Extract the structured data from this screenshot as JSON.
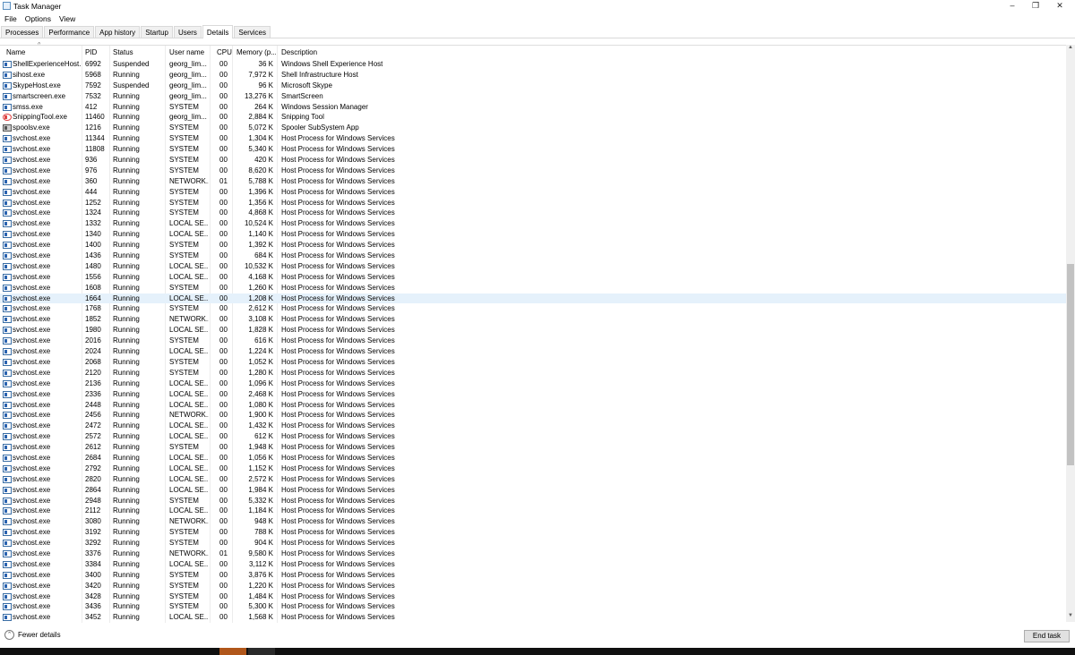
{
  "window": {
    "title": "Task Manager",
    "minimize": "–",
    "restore": "❐",
    "close": "✕"
  },
  "menu": [
    "File",
    "Options",
    "View"
  ],
  "tabs": [
    "Processes",
    "Performance",
    "App history",
    "Startup",
    "Users",
    "Details",
    "Services"
  ],
  "active_tab": "Details",
  "columns": [
    "Name",
    "PID",
    "Status",
    "User name",
    "CPU",
    "Memory (p...",
    "Description"
  ],
  "sort_indicator": "^",
  "rows": [
    [
      "ShellExperienceHost....",
      "6992",
      "Suspended",
      "georg_lim...",
      "00",
      "36 K",
      "Windows Shell Experience Host",
      "app"
    ],
    [
      "sihost.exe",
      "5968",
      "Running",
      "georg_lim...",
      "00",
      "7,972 K",
      "Shell Infrastructure Host",
      "app"
    ],
    [
      "SkypeHost.exe",
      "7592",
      "Suspended",
      "georg_lim...",
      "00",
      "96 K",
      "Microsoft Skype",
      "app"
    ],
    [
      "smartscreen.exe",
      "7532",
      "Running",
      "georg_lim...",
      "00",
      "13,276 K",
      "SmartScreen",
      "app"
    ],
    [
      "smss.exe",
      "412",
      "Running",
      "SYSTEM",
      "00",
      "264 K",
      "Windows Session Manager",
      "app"
    ],
    [
      "SnippingTool.exe",
      "11460",
      "Running",
      "georg_lim...",
      "00",
      "2,884 K",
      "Snipping Tool",
      "snip"
    ],
    [
      "spoolsv.exe",
      "1216",
      "Running",
      "SYSTEM",
      "00",
      "5,072 K",
      "Spooler SubSystem App",
      "print"
    ],
    [
      "svchost.exe",
      "11344",
      "Running",
      "SYSTEM",
      "00",
      "1,304 K",
      "Host Process for Windows Services",
      "app"
    ],
    [
      "svchost.exe",
      "11808",
      "Running",
      "SYSTEM",
      "00",
      "5,340 K",
      "Host Process for Windows Services",
      "app"
    ],
    [
      "svchost.exe",
      "936",
      "Running",
      "SYSTEM",
      "00",
      "420 K",
      "Host Process for Windows Services",
      "app"
    ],
    [
      "svchost.exe",
      "976",
      "Running",
      "SYSTEM",
      "00",
      "8,620 K",
      "Host Process for Windows Services",
      "app"
    ],
    [
      "svchost.exe",
      "360",
      "Running",
      "NETWORK...",
      "01",
      "5,788 K",
      "Host Process for Windows Services",
      "app"
    ],
    [
      "svchost.exe",
      "444",
      "Running",
      "SYSTEM",
      "00",
      "1,396 K",
      "Host Process for Windows Services",
      "app"
    ],
    [
      "svchost.exe",
      "1252",
      "Running",
      "SYSTEM",
      "00",
      "1,356 K",
      "Host Process for Windows Services",
      "app"
    ],
    [
      "svchost.exe",
      "1324",
      "Running",
      "SYSTEM",
      "00",
      "4,868 K",
      "Host Process for Windows Services",
      "app"
    ],
    [
      "svchost.exe",
      "1332",
      "Running",
      "LOCAL SE...",
      "00",
      "10,524 K",
      "Host Process for Windows Services",
      "app"
    ],
    [
      "svchost.exe",
      "1340",
      "Running",
      "LOCAL SE...",
      "00",
      "1,140 K",
      "Host Process for Windows Services",
      "app"
    ],
    [
      "svchost.exe",
      "1400",
      "Running",
      "SYSTEM",
      "00",
      "1,392 K",
      "Host Process for Windows Services",
      "app"
    ],
    [
      "svchost.exe",
      "1436",
      "Running",
      "SYSTEM",
      "00",
      "684 K",
      "Host Process for Windows Services",
      "app"
    ],
    [
      "svchost.exe",
      "1480",
      "Running",
      "LOCAL SE...",
      "00",
      "10,532 K",
      "Host Process for Windows Services",
      "app"
    ],
    [
      "svchost.exe",
      "1556",
      "Running",
      "LOCAL SE...",
      "00",
      "4,168 K",
      "Host Process for Windows Services",
      "app"
    ],
    [
      "svchost.exe",
      "1608",
      "Running",
      "SYSTEM",
      "00",
      "1,260 K",
      "Host Process for Windows Services",
      "app"
    ],
    [
      "svchost.exe",
      "1664",
      "Running",
      "LOCAL SE...",
      "00",
      "1,208 K",
      "Host Process for Windows Services",
      "app"
    ],
    [
      "svchost.exe",
      "1768",
      "Running",
      "SYSTEM",
      "00",
      "2,612 K",
      "Host Process for Windows Services",
      "app"
    ],
    [
      "svchost.exe",
      "1852",
      "Running",
      "NETWORK...",
      "00",
      "3,108 K",
      "Host Process for Windows Services",
      "app"
    ],
    [
      "svchost.exe",
      "1980",
      "Running",
      "LOCAL SE...",
      "00",
      "1,828 K",
      "Host Process for Windows Services",
      "app"
    ],
    [
      "svchost.exe",
      "2016",
      "Running",
      "SYSTEM",
      "00",
      "616 K",
      "Host Process for Windows Services",
      "app"
    ],
    [
      "svchost.exe",
      "2024",
      "Running",
      "LOCAL SE...",
      "00",
      "1,224 K",
      "Host Process for Windows Services",
      "app"
    ],
    [
      "svchost.exe",
      "2068",
      "Running",
      "SYSTEM",
      "00",
      "1,052 K",
      "Host Process for Windows Services",
      "app"
    ],
    [
      "svchost.exe",
      "2120",
      "Running",
      "SYSTEM",
      "00",
      "1,280 K",
      "Host Process for Windows Services",
      "app"
    ],
    [
      "svchost.exe",
      "2136",
      "Running",
      "LOCAL SE...",
      "00",
      "1,096 K",
      "Host Process for Windows Services",
      "app"
    ],
    [
      "svchost.exe",
      "2336",
      "Running",
      "LOCAL SE...",
      "00",
      "2,468 K",
      "Host Process for Windows Services",
      "app"
    ],
    [
      "svchost.exe",
      "2448",
      "Running",
      "LOCAL SE...",
      "00",
      "1,080 K",
      "Host Process for Windows Services",
      "app"
    ],
    [
      "svchost.exe",
      "2456",
      "Running",
      "NETWORK...",
      "00",
      "1,900 K",
      "Host Process for Windows Services",
      "app"
    ],
    [
      "svchost.exe",
      "2472",
      "Running",
      "LOCAL SE...",
      "00",
      "1,432 K",
      "Host Process for Windows Services",
      "app"
    ],
    [
      "svchost.exe",
      "2572",
      "Running",
      "LOCAL SE...",
      "00",
      "612 K",
      "Host Process for Windows Services",
      "app"
    ],
    [
      "svchost.exe",
      "2612",
      "Running",
      "SYSTEM",
      "00",
      "1,948 K",
      "Host Process for Windows Services",
      "app"
    ],
    [
      "svchost.exe",
      "2684",
      "Running",
      "LOCAL SE...",
      "00",
      "1,056 K",
      "Host Process for Windows Services",
      "app"
    ],
    [
      "svchost.exe",
      "2792",
      "Running",
      "LOCAL SE...",
      "00",
      "1,152 K",
      "Host Process for Windows Services",
      "app"
    ],
    [
      "svchost.exe",
      "2820",
      "Running",
      "LOCAL SE...",
      "00",
      "2,572 K",
      "Host Process for Windows Services",
      "app"
    ],
    [
      "svchost.exe",
      "2864",
      "Running",
      "LOCAL SE...",
      "00",
      "1,984 K",
      "Host Process for Windows Services",
      "app"
    ],
    [
      "svchost.exe",
      "2948",
      "Running",
      "SYSTEM",
      "00",
      "5,332 K",
      "Host Process for Windows Services",
      "app"
    ],
    [
      "svchost.exe",
      "2112",
      "Running",
      "LOCAL SE...",
      "00",
      "1,184 K",
      "Host Process for Windows Services",
      "app"
    ],
    [
      "svchost.exe",
      "3080",
      "Running",
      "NETWORK...",
      "00",
      "948 K",
      "Host Process for Windows Services",
      "app"
    ],
    [
      "svchost.exe",
      "3192",
      "Running",
      "SYSTEM",
      "00",
      "788 K",
      "Host Process for Windows Services",
      "app"
    ],
    [
      "svchost.exe",
      "3292",
      "Running",
      "SYSTEM",
      "00",
      "904 K",
      "Host Process for Windows Services",
      "app"
    ],
    [
      "svchost.exe",
      "3376",
      "Running",
      "NETWORK...",
      "01",
      "9,580 K",
      "Host Process for Windows Services",
      "app"
    ],
    [
      "svchost.exe",
      "3384",
      "Running",
      "LOCAL SE...",
      "00",
      "3,112 K",
      "Host Process for Windows Services",
      "app"
    ],
    [
      "svchost.exe",
      "3400",
      "Running",
      "SYSTEM",
      "00",
      "3,876 K",
      "Host Process for Windows Services",
      "app"
    ],
    [
      "svchost.exe",
      "3420",
      "Running",
      "SYSTEM",
      "00",
      "1,220 K",
      "Host Process for Windows Services",
      "app"
    ],
    [
      "svchost.exe",
      "3428",
      "Running",
      "SYSTEM",
      "00",
      "1,484 K",
      "Host Process for Windows Services",
      "app"
    ],
    [
      "svchost.exe",
      "3436",
      "Running",
      "SYSTEM",
      "00",
      "5,300 K",
      "Host Process for Windows Services",
      "app"
    ],
    [
      "svchost.exe",
      "3452",
      "Running",
      "LOCAL SE...",
      "00",
      "1,568 K",
      "Host Process for Windows Services",
      "app"
    ]
  ],
  "selected_pid": "1664",
  "footer": {
    "fewer_details": "Fewer details",
    "end_task": "End task"
  },
  "colors": {
    "selected_row": "#e5f1fb",
    "taskbar": "#101010"
  }
}
